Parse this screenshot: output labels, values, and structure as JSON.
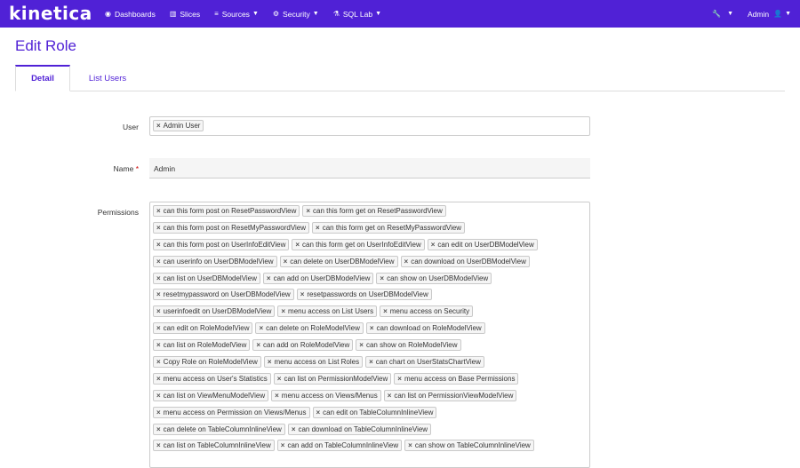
{
  "brand": {
    "logo_text": "kinetica",
    "primary_color": "#5021d6"
  },
  "nav": {
    "items": [
      {
        "label": "Dashboards",
        "icon": "dashboard-icon"
      },
      {
        "label": "Slices",
        "icon": "bar-chart-icon"
      },
      {
        "label": "Sources",
        "icon": "database-icon"
      },
      {
        "label": "Security",
        "icon": "cogs-icon"
      },
      {
        "label": "SQL Lab",
        "icon": "flask-icon"
      }
    ],
    "right": {
      "tools_icon": "wrench-icon",
      "user_label": "Admin",
      "user_icon": "user-icon"
    }
  },
  "page": {
    "title": "Edit Role"
  },
  "tabs": {
    "detail": "Detail",
    "list_users": "List Users"
  },
  "form": {
    "user_label": "User",
    "user_tags": [
      "Admin User"
    ],
    "name_label": "Name",
    "name_required": "*",
    "name_value": "Admin",
    "permissions_label": "Permissions",
    "permissions": [
      [
        "can this form post on ResetPasswordView",
        "can this form get on ResetPasswordView"
      ],
      [
        "can this form post on ResetMyPasswordView",
        "can this form get on ResetMyPasswordView"
      ],
      [
        "can this form post on UserInfoEditView",
        "can this form get on UserInfoEditView",
        "can edit on UserDBModelView"
      ],
      [
        "can userinfo on UserDBModelView",
        "can delete on UserDBModelView",
        "can download on UserDBModelView"
      ],
      [
        "can list on UserDBModelView",
        "can add on UserDBModelView",
        "can show on UserDBModelView"
      ],
      [
        "resetmypassword on UserDBModelView",
        "resetpasswords on UserDBModelView"
      ],
      [
        "userinfoedit on UserDBModelView",
        "menu access on List Users",
        "menu access on Security"
      ],
      [
        "can edit on RoleModelView",
        "can delete on RoleModelView",
        "can download on RoleModelView"
      ],
      [
        "can list on RoleModelView",
        "can add on RoleModelView",
        "can show on RoleModelView"
      ],
      [
        "Copy Role on RoleModelView",
        "menu access on List Roles",
        "can chart on UserStatsChartView"
      ],
      [
        "menu access on User's Statistics",
        "can list on PermissionModelView",
        "menu access on Base Permissions"
      ],
      [
        "can list on ViewMenuModelView",
        "menu access on Views/Menus",
        "can list on PermissionViewModelView"
      ],
      [
        "menu access on Permission on Views/Menus",
        "can edit on TableColumnInlineView"
      ],
      [
        "can delete on TableColumnInlineView",
        "can download on TableColumnInlineView"
      ],
      [
        "can list on TableColumnInlineView",
        "can add on TableColumnInlineView",
        "can show on TableColumnInlineView"
      ]
    ]
  }
}
